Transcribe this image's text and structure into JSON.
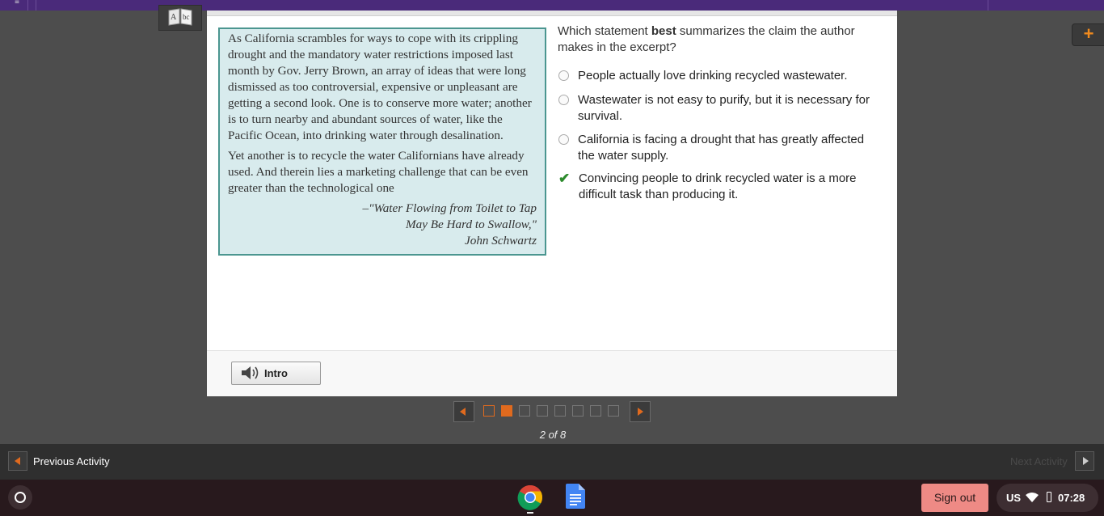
{
  "colors": {
    "accent": "#e06a1e",
    "passage_bg": "#d8ebed",
    "passage_border": "#4b9690",
    "correct": "#2c8a2c",
    "signout": "#ee8a85"
  },
  "passage": {
    "paragraphs": [
      "As California scrambles for ways to cope with its crippling drought and the mandatory water restrictions imposed last month by Gov. Jerry Brown, an array of ideas that were long dismissed as too controversial, expensive or unpleasant are getting a second look. One is to conserve more water; another is to turn nearby and abundant sources of water, like the Pacific Ocean, into drinking water through desalination.",
      "Yet another is to recycle the water Californians have already used. And therein lies a marketing challenge that can be even greater than the technological one"
    ],
    "citation": [
      "–\"Water Flowing from Toilet to Tap",
      "May Be Hard to Swallow,\"",
      "John Schwartz"
    ]
  },
  "question": {
    "prefix": "Which statement ",
    "emphasis": "best",
    "suffix": " summarizes the claim the author makes in the excerpt?"
  },
  "options": [
    {
      "text": "People actually love drinking recycled wastewater.",
      "state": "unselected"
    },
    {
      "text": "Wastewater is not easy to purify, but it is necessary for survival.",
      "state": "unselected"
    },
    {
      "text": "California is facing a drought that has greatly affected the water supply.",
      "state": "unselected"
    },
    {
      "text": "Convincing people to drink recycled water is a more difficult task than producing it.",
      "state": "correct"
    }
  ],
  "footer": {
    "intro_label": "Intro"
  },
  "pager": {
    "current": 2,
    "total": 8,
    "label": "2 of 8"
  },
  "activity_nav": {
    "prev_label": "Previous Activity",
    "next_label": "Next Activity"
  },
  "shelf": {
    "signout_label": "Sign out",
    "language": "US",
    "time": "07:28"
  },
  "icons": [
    "menu-icon",
    "dictionary-icon",
    "plus-icon",
    "speaker-icon",
    "chevron-left-icon",
    "chevron-right-icon",
    "launcher-icon",
    "chrome-icon",
    "docs-icon",
    "wifi-icon",
    "battery-icon",
    "check-icon"
  ]
}
